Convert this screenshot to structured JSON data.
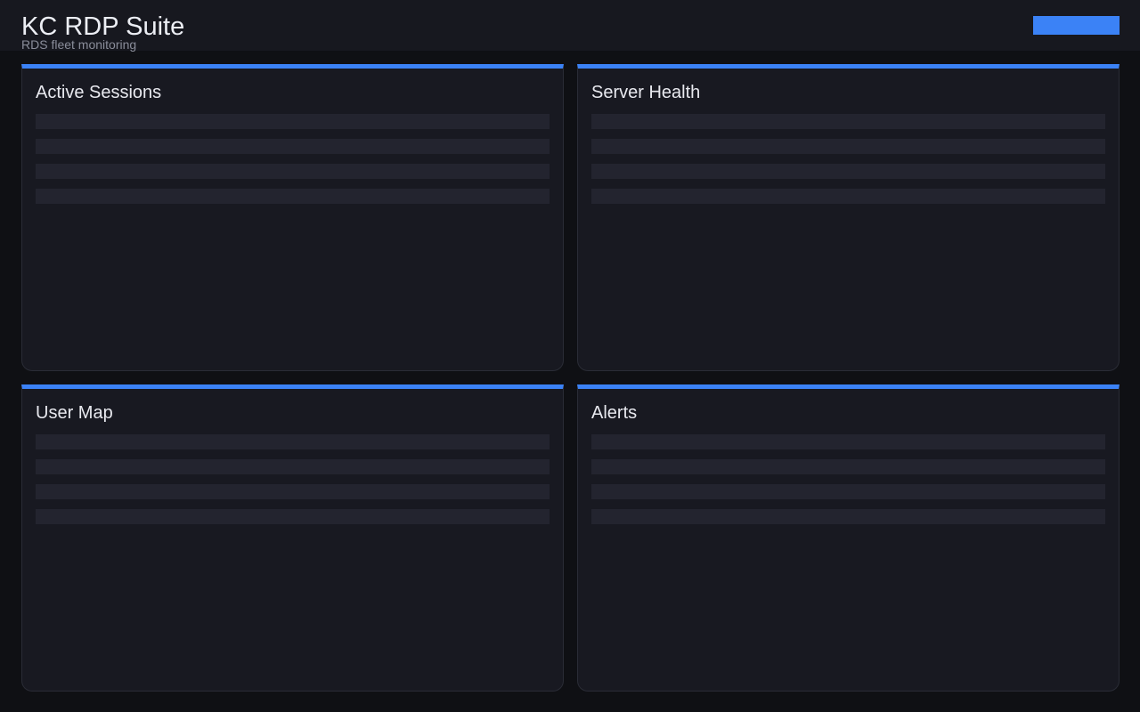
{
  "header": {
    "title": "KC RDP Suite",
    "subtitle": "RDS fleet monitoring",
    "action_color": "#3b82f6"
  },
  "panels": [
    {
      "title": "Active Sessions",
      "rows": 4
    },
    {
      "title": "Server Health",
      "rows": 4
    },
    {
      "title": "User Map",
      "rows": 4
    },
    {
      "title": "Alerts",
      "rows": 4
    }
  ],
  "theme": {
    "accent": "#3b82f6",
    "background": "#0f1014",
    "panel": "#181921",
    "skeleton": "#23242f"
  }
}
